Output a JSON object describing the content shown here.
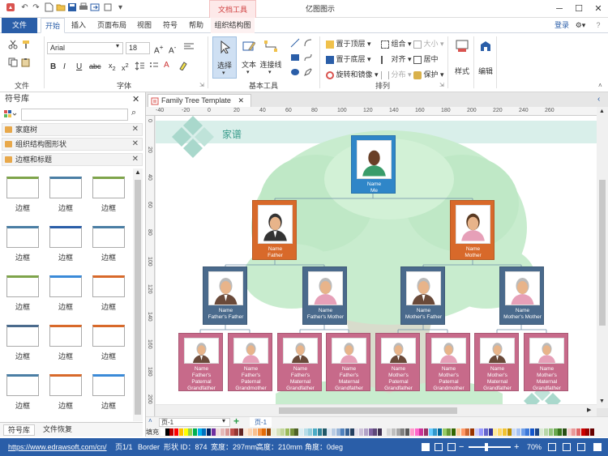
{
  "app": {
    "title": "亿图图示",
    "context_tab": "文档工具"
  },
  "tabs": [
    {
      "label": "文件"
    },
    {
      "label": "开始"
    },
    {
      "label": "插入"
    },
    {
      "label": "页面布局"
    },
    {
      "label": "视图"
    },
    {
      "label": "符号"
    },
    {
      "label": "帮助"
    },
    {
      "label": "组织结构图"
    }
  ],
  "account": {
    "login": "登录"
  },
  "ribbon": {
    "groups": {
      "file": "文件",
      "font": "字体",
      "tools": "基本工具",
      "arrange": "排列"
    },
    "font_name": "Arial",
    "font_size": "18",
    "bold": "B",
    "italic": "I",
    "underline": "U",
    "strike": "abc",
    "select": "选择",
    "text": "文本",
    "connector": "连接线",
    "bring_front": "置于顶层",
    "send_back": "置于底层",
    "rotate_mirror": "旋转和镜像",
    "group": "组合",
    "align": "对齐",
    "distribute": "分布",
    "size": "大小",
    "center": "居中",
    "protect": "保护",
    "style": "样式",
    "edit": "编辑"
  },
  "library": {
    "title": "符号库",
    "search_placeholder": "",
    "sections": [
      {
        "label": "家庭树"
      },
      {
        "label": "组织结构图形状"
      },
      {
        "label": "边框和标题"
      }
    ],
    "items": [
      "边框",
      "边框",
      "边框",
      "边框",
      "边框",
      "边框",
      "边框",
      "边框",
      "边框",
      "边框",
      "边框",
      "边框",
      "边框",
      "边框",
      "边框"
    ],
    "bottom_tabs": [
      "符号库",
      "文件恢复"
    ]
  },
  "document": {
    "tab_label": "Family Tree Template",
    "page_heading": "家谱",
    "ruler_top": [
      "-40",
      "-20",
      "0",
      "20",
      "40",
      "60",
      "80",
      "100",
      "120",
      "140",
      "160",
      "180",
      "200",
      "220",
      "240",
      "260"
    ],
    "ruler_left": [
      "0",
      "20",
      "40",
      "60",
      "80",
      "100",
      "120",
      "140",
      "160",
      "180",
      "200"
    ],
    "page_selector": "页-1",
    "page_tab": "页-1",
    "fill_label": "填充"
  },
  "family": {
    "me": {
      "name": "Name",
      "role": "Me"
    },
    "parents": [
      {
        "name": "Name",
        "role": "Father"
      },
      {
        "name": "Name",
        "role": "Mother"
      }
    ],
    "grandparents": [
      {
        "name": "Name",
        "role": "Father's Father"
      },
      {
        "name": "Name",
        "role": "Father's Mother"
      },
      {
        "name": "Name",
        "role": "Mother's Father"
      },
      {
        "name": "Name",
        "role": "Mother's Mother"
      }
    ],
    "great_grandparents": [
      {
        "name": "Name",
        "l1": "Father's",
        "l2": "Paternal",
        "l3": "Grandfather"
      },
      {
        "name": "Name",
        "l1": "Father's",
        "l2": "Paternal",
        "l3": "Grandmother"
      },
      {
        "name": "Name",
        "l1": "Father's",
        "l2": "Maternal",
        "l3": "Grandfather"
      },
      {
        "name": "Name",
        "l1": "Father's",
        "l2": "Maternal",
        "l3": "Grandfather"
      },
      {
        "name": "Name",
        "l1": "Mother's",
        "l2": "Paternal",
        "l3": "Grandfather"
      },
      {
        "name": "Name",
        "l1": "Mother's",
        "l2": "Paternal",
        "l3": "Grandmother"
      },
      {
        "name": "Name",
        "l1": "Mother's",
        "l2": "Maternal",
        "l3": "Grandfather"
      },
      {
        "name": "Name",
        "l1": "Mother's",
        "l2": "Maternal",
        "l3": "Grandfather"
      }
    ]
  },
  "colors": {
    "accent": "#2a5ea8",
    "me_card": "#2f86c8",
    "parent_card": "#d8692a",
    "grandparent_card": "#4a6a8c",
    "great_card": "#c76a8a",
    "tree": "#bfe8c6",
    "header_band": "#d9efea"
  },
  "status": {
    "url": "https://www.edrawsoft.com/cn/",
    "page": "页1/1",
    "shape_name": "Border",
    "shape_id": "形状 ID：874",
    "width": "宽度：297mm",
    "height": "高度：210mm",
    "angle": "角度：0deg",
    "zoom": "70%"
  }
}
